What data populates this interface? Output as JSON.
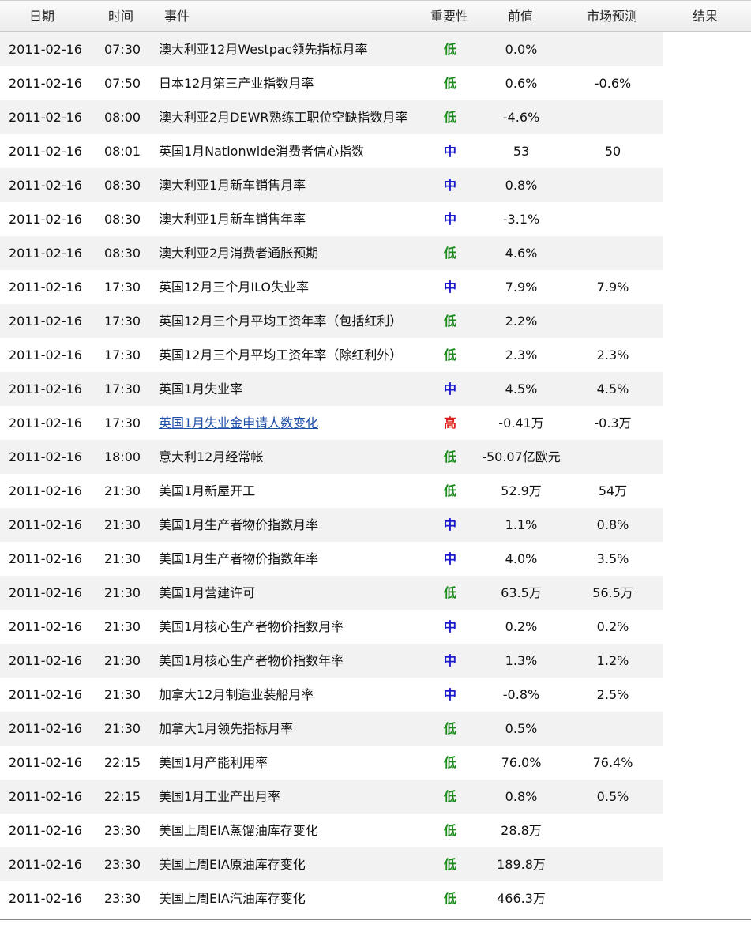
{
  "colors": {
    "low": "#1a8a1a",
    "medium": "#1a1acc",
    "high": "#e0201a",
    "link": "#1f4fa8"
  },
  "header": {
    "date": "日期",
    "time": "时间",
    "event": "事件",
    "importance": "重要性",
    "previous": "前值",
    "forecast": "市场预测",
    "result": "结果"
  },
  "rows": [
    {
      "date": "2011-02-16",
      "time": "07:30",
      "event": "澳大利亚12月Westpac领先指标月率",
      "importance": "低",
      "level": "low",
      "previous": "0.0%",
      "forecast": "",
      "result": ""
    },
    {
      "date": "2011-02-16",
      "time": "07:50",
      "event": "日本12月第三产业指数月率",
      "importance": "低",
      "level": "low",
      "previous": "0.6%",
      "forecast": "-0.6%",
      "result": ""
    },
    {
      "date": "2011-02-16",
      "time": "08:00",
      "event": "澳大利亚2月DEWR熟练工职位空缺指数月率",
      "importance": "低",
      "level": "low",
      "previous": "-4.6%",
      "forecast": "",
      "result": ""
    },
    {
      "date": "2011-02-16",
      "time": "08:01",
      "event": "英国1月Nationwide消费者信心指数",
      "importance": "中",
      "level": "medium",
      "previous": "53",
      "forecast": "50",
      "result": ""
    },
    {
      "date": "2011-02-16",
      "time": "08:30",
      "event": "澳大利亚1月新车销售月率",
      "importance": "中",
      "level": "medium",
      "previous": "0.8%",
      "forecast": "",
      "result": ""
    },
    {
      "date": "2011-02-16",
      "time": "08:30",
      "event": "澳大利亚1月新车销售年率",
      "importance": "中",
      "level": "medium",
      "previous": "-3.1%",
      "forecast": "",
      "result": ""
    },
    {
      "date": "2011-02-16",
      "time": "08:30",
      "event": "澳大利亚2月消费者通胀预期",
      "importance": "低",
      "level": "low",
      "previous": "4.6%",
      "forecast": "",
      "result": ""
    },
    {
      "date": "2011-02-16",
      "time": "17:30",
      "event": "英国12月三个月ILO失业率",
      "importance": "中",
      "level": "medium",
      "previous": "7.9%",
      "forecast": "7.9%",
      "result": ""
    },
    {
      "date": "2011-02-16",
      "time": "17:30",
      "event": "英国12月三个月平均工资年率（包括红利）",
      "importance": "低",
      "level": "low",
      "previous": "2.2%",
      "forecast": "",
      "result": ""
    },
    {
      "date": "2011-02-16",
      "time": "17:30",
      "event": "英国12月三个月平均工资年率（除红利外）",
      "importance": "低",
      "level": "low",
      "previous": "2.3%",
      "forecast": "2.3%",
      "result": ""
    },
    {
      "date": "2011-02-16",
      "time": "17:30",
      "event": "英国1月失业率",
      "importance": "中",
      "level": "medium",
      "previous": "4.5%",
      "forecast": "4.5%",
      "result": ""
    },
    {
      "date": "2011-02-16",
      "time": "17:30",
      "event": "英国1月失业金申请人数变化",
      "importance": "高",
      "level": "high",
      "previous": "-0.41万",
      "forecast": "-0.3万",
      "result": "",
      "link": true
    },
    {
      "date": "2011-02-16",
      "time": "18:00",
      "event": "意大利12月经常帐",
      "importance": "低",
      "level": "low",
      "previous": "-50.07亿欧元",
      "forecast": "",
      "result": ""
    },
    {
      "date": "2011-02-16",
      "time": "21:30",
      "event": "美国1月新屋开工",
      "importance": "低",
      "level": "low",
      "previous": "52.9万",
      "forecast": "54万",
      "result": ""
    },
    {
      "date": "2011-02-16",
      "time": "21:30",
      "event": "美国1月生产者物价指数月率",
      "importance": "中",
      "level": "medium",
      "previous": "1.1%",
      "forecast": "0.8%",
      "result": ""
    },
    {
      "date": "2011-02-16",
      "time": "21:30",
      "event": "美国1月生产者物价指数年率",
      "importance": "中",
      "level": "medium",
      "previous": "4.0%",
      "forecast": "3.5%",
      "result": ""
    },
    {
      "date": "2011-02-16",
      "time": "21:30",
      "event": "美国1月营建许可",
      "importance": "低",
      "level": "low",
      "previous": "63.5万",
      "forecast": "56.5万",
      "result": ""
    },
    {
      "date": "2011-02-16",
      "time": "21:30",
      "event": "美国1月核心生产者物价指数月率",
      "importance": "中",
      "level": "medium",
      "previous": "0.2%",
      "forecast": "0.2%",
      "result": ""
    },
    {
      "date": "2011-02-16",
      "time": "21:30",
      "event": "美国1月核心生产者物价指数年率",
      "importance": "中",
      "level": "medium",
      "previous": "1.3%",
      "forecast": "1.2%",
      "result": ""
    },
    {
      "date": "2011-02-16",
      "time": "21:30",
      "event": "加拿大12月制造业装船月率",
      "importance": "中",
      "level": "medium",
      "previous": "-0.8%",
      "forecast": "2.5%",
      "result": ""
    },
    {
      "date": "2011-02-16",
      "time": "21:30",
      "event": "加拿大1月领先指标月率",
      "importance": "低",
      "level": "low",
      "previous": "0.5%",
      "forecast": "",
      "result": ""
    },
    {
      "date": "2011-02-16",
      "time": "22:15",
      "event": "美国1月产能利用率",
      "importance": "低",
      "level": "low",
      "previous": "76.0%",
      "forecast": "76.4%",
      "result": ""
    },
    {
      "date": "2011-02-16",
      "time": "22:15",
      "event": "美国1月工业产出月率",
      "importance": "低",
      "level": "low",
      "previous": "0.8%",
      "forecast": "0.5%",
      "result": ""
    },
    {
      "date": "2011-02-16",
      "time": "23:30",
      "event": "美国上周EIA蒸馏油库存变化",
      "importance": "低",
      "level": "low",
      "previous": "28.8万",
      "forecast": "",
      "result": ""
    },
    {
      "date": "2011-02-16",
      "time": "23:30",
      "event": "美国上周EIA原油库存变化",
      "importance": "低",
      "level": "low",
      "previous": "189.8万",
      "forecast": "",
      "result": ""
    },
    {
      "date": "2011-02-16",
      "time": "23:30",
      "event": "美国上周EIA汽油库存变化",
      "importance": "低",
      "level": "low",
      "previous": "466.3万",
      "forecast": "",
      "result": ""
    }
  ]
}
